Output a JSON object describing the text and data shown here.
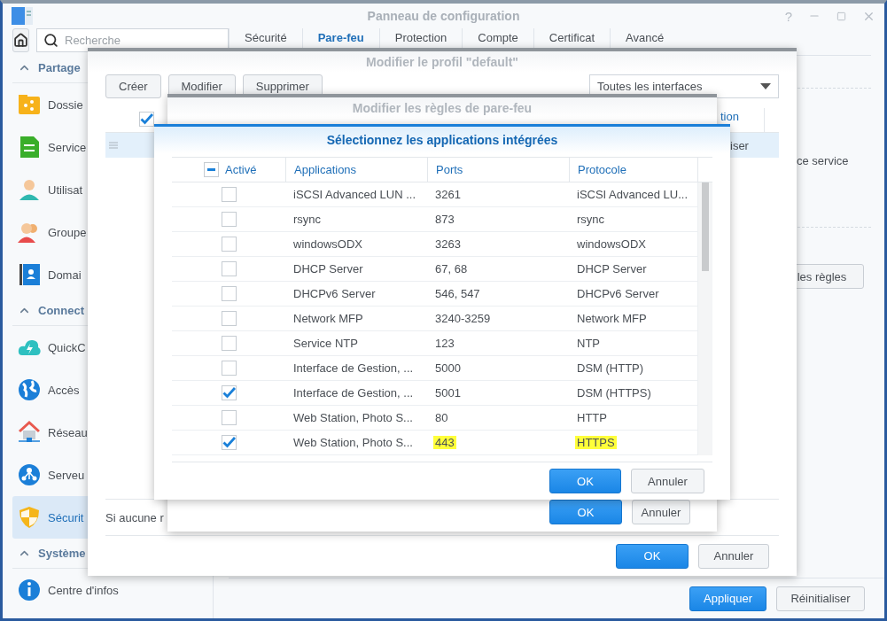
{
  "window": {
    "title": "Panneau de configuration",
    "help": "?"
  },
  "sidebar": {
    "search": {
      "placeholder": "Recherche"
    },
    "sections": [
      {
        "title": "Partage",
        "expanded": true,
        "items": [
          {
            "label": "Dossie",
            "selected": false
          },
          {
            "label": "Service",
            "selected": false
          },
          {
            "label": "Utilisat",
            "selected": false
          },
          {
            "label": "Groupe",
            "selected": false
          },
          {
            "label": "Domai",
            "selected": false
          }
        ]
      },
      {
        "title": "Connect",
        "expanded": true,
        "items": [
          {
            "label": "QuickC",
            "selected": false
          },
          {
            "label": "Accès",
            "selected": false
          },
          {
            "label": "Réseau",
            "selected": false
          },
          {
            "label": "Serveu",
            "selected": false
          },
          {
            "label": "Sécurit",
            "selected": true
          }
        ]
      },
      {
        "title": "Système",
        "expanded": true,
        "items": [
          {
            "label": "Centre d'infos",
            "selected": false
          }
        ]
      }
    ]
  },
  "tabs": [
    {
      "label": "Sécurité",
      "selected": false
    },
    {
      "label": "Pare-feu",
      "selected": true
    },
    {
      "label": "Protection",
      "selected": false
    },
    {
      "label": "Compte",
      "selected": false
    },
    {
      "label": "Certificat",
      "selected": false
    },
    {
      "label": "Avancé",
      "selected": false
    }
  ],
  "content": {
    "text": "ce service",
    "rules_button": "les règles",
    "buttons": [
      "Appliquer",
      "Réinitialiser"
    ]
  },
  "profile_dialog": {
    "title": "Modifier le profil \"default\"",
    "toolbar": [
      "Créer",
      "Modifier",
      "Supprimer"
    ],
    "interface_select": "Toutes les interfaces",
    "header_checked": true,
    "column_5": "tion",
    "rows": [
      {
        "action": "iser",
        "selected": true
      }
    ],
    "note": "Si aucune r",
    "buttons": [
      "OK",
      "Annuler"
    ]
  },
  "rules_dialog": {
    "title": "Modifier les règles de pare-feu",
    "buttons": [
      "OK",
      "Annuler"
    ]
  },
  "apps_dialog": {
    "title": "Sélectionnez les applications intégrées",
    "select_all_partial": true,
    "columns": [
      "Activé",
      "Applications",
      "Ports",
      "Protocole"
    ],
    "rows": [
      {
        "checked": false,
        "application": "iSCSI Advanced LUN ...",
        "ports": "3261",
        "protocol": "iSCSI Advanced LU...",
        "highlighted": false
      },
      {
        "checked": false,
        "application": "rsync",
        "ports": "873",
        "protocol": "rsync",
        "highlighted": false
      },
      {
        "checked": false,
        "application": "windowsODX",
        "ports": "3263",
        "protocol": "windowsODX",
        "highlighted": false
      },
      {
        "checked": false,
        "application": "DHCP Server",
        "ports": "67, 68",
        "protocol": "DHCP Server",
        "highlighted": false
      },
      {
        "checked": false,
        "application": "DHCPv6 Server",
        "ports": "546, 547",
        "protocol": "DHCPv6 Server",
        "highlighted": false
      },
      {
        "checked": false,
        "application": "Network MFP",
        "ports": "3240-3259",
        "protocol": "Network MFP",
        "highlighted": false
      },
      {
        "checked": false,
        "application": "Service NTP",
        "ports": "123",
        "protocol": "NTP",
        "highlighted": false
      },
      {
        "checked": false,
        "application": "Interface de Gestion, ...",
        "ports": "5000",
        "protocol": "DSM (HTTP)",
        "highlighted": false
      },
      {
        "checked": true,
        "application": "Interface de Gestion, ...",
        "ports": "5001",
        "protocol": "DSM (HTTPS)",
        "highlighted": false
      },
      {
        "checked": false,
        "application": "Web Station, Photo S...",
        "ports": "80",
        "protocol": "HTTP",
        "highlighted": false
      },
      {
        "checked": true,
        "application": "Web Station, Photo S...",
        "ports": "443",
        "protocol": "HTTPS",
        "highlighted": true
      }
    ],
    "buttons": [
      "OK",
      "Annuler"
    ]
  }
}
